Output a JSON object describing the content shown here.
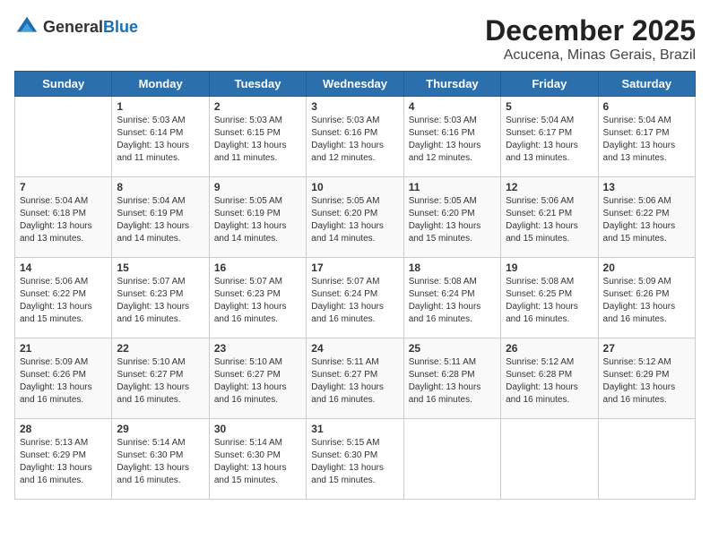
{
  "logo": {
    "general": "General",
    "blue": "Blue"
  },
  "title": {
    "month": "December 2025",
    "location": "Acucena, Minas Gerais, Brazil"
  },
  "weekdays": [
    "Sunday",
    "Monday",
    "Tuesday",
    "Wednesday",
    "Thursday",
    "Friday",
    "Saturday"
  ],
  "weeks": [
    [
      {
        "day": "",
        "info": ""
      },
      {
        "day": "1",
        "info": "Sunrise: 5:03 AM\nSunset: 6:14 PM\nDaylight: 13 hours\nand 11 minutes."
      },
      {
        "day": "2",
        "info": "Sunrise: 5:03 AM\nSunset: 6:15 PM\nDaylight: 13 hours\nand 11 minutes."
      },
      {
        "day": "3",
        "info": "Sunrise: 5:03 AM\nSunset: 6:16 PM\nDaylight: 13 hours\nand 12 minutes."
      },
      {
        "day": "4",
        "info": "Sunrise: 5:03 AM\nSunset: 6:16 PM\nDaylight: 13 hours\nand 12 minutes."
      },
      {
        "day": "5",
        "info": "Sunrise: 5:04 AM\nSunset: 6:17 PM\nDaylight: 13 hours\nand 13 minutes."
      },
      {
        "day": "6",
        "info": "Sunrise: 5:04 AM\nSunset: 6:17 PM\nDaylight: 13 hours\nand 13 minutes."
      }
    ],
    [
      {
        "day": "7",
        "info": "Sunrise: 5:04 AM\nSunset: 6:18 PM\nDaylight: 13 hours\nand 13 minutes."
      },
      {
        "day": "8",
        "info": "Sunrise: 5:04 AM\nSunset: 6:19 PM\nDaylight: 13 hours\nand 14 minutes."
      },
      {
        "day": "9",
        "info": "Sunrise: 5:05 AM\nSunset: 6:19 PM\nDaylight: 13 hours\nand 14 minutes."
      },
      {
        "day": "10",
        "info": "Sunrise: 5:05 AM\nSunset: 6:20 PM\nDaylight: 13 hours\nand 14 minutes."
      },
      {
        "day": "11",
        "info": "Sunrise: 5:05 AM\nSunset: 6:20 PM\nDaylight: 13 hours\nand 15 minutes."
      },
      {
        "day": "12",
        "info": "Sunrise: 5:06 AM\nSunset: 6:21 PM\nDaylight: 13 hours\nand 15 minutes."
      },
      {
        "day": "13",
        "info": "Sunrise: 5:06 AM\nSunset: 6:22 PM\nDaylight: 13 hours\nand 15 minutes."
      }
    ],
    [
      {
        "day": "14",
        "info": "Sunrise: 5:06 AM\nSunset: 6:22 PM\nDaylight: 13 hours\nand 15 minutes."
      },
      {
        "day": "15",
        "info": "Sunrise: 5:07 AM\nSunset: 6:23 PM\nDaylight: 13 hours\nand 16 minutes."
      },
      {
        "day": "16",
        "info": "Sunrise: 5:07 AM\nSunset: 6:23 PM\nDaylight: 13 hours\nand 16 minutes."
      },
      {
        "day": "17",
        "info": "Sunrise: 5:07 AM\nSunset: 6:24 PM\nDaylight: 13 hours\nand 16 minutes."
      },
      {
        "day": "18",
        "info": "Sunrise: 5:08 AM\nSunset: 6:24 PM\nDaylight: 13 hours\nand 16 minutes."
      },
      {
        "day": "19",
        "info": "Sunrise: 5:08 AM\nSunset: 6:25 PM\nDaylight: 13 hours\nand 16 minutes."
      },
      {
        "day": "20",
        "info": "Sunrise: 5:09 AM\nSunset: 6:26 PM\nDaylight: 13 hours\nand 16 minutes."
      }
    ],
    [
      {
        "day": "21",
        "info": "Sunrise: 5:09 AM\nSunset: 6:26 PM\nDaylight: 13 hours\nand 16 minutes."
      },
      {
        "day": "22",
        "info": "Sunrise: 5:10 AM\nSunset: 6:27 PM\nDaylight: 13 hours\nand 16 minutes."
      },
      {
        "day": "23",
        "info": "Sunrise: 5:10 AM\nSunset: 6:27 PM\nDaylight: 13 hours\nand 16 minutes."
      },
      {
        "day": "24",
        "info": "Sunrise: 5:11 AM\nSunset: 6:27 PM\nDaylight: 13 hours\nand 16 minutes."
      },
      {
        "day": "25",
        "info": "Sunrise: 5:11 AM\nSunset: 6:28 PM\nDaylight: 13 hours\nand 16 minutes."
      },
      {
        "day": "26",
        "info": "Sunrise: 5:12 AM\nSunset: 6:28 PM\nDaylight: 13 hours\nand 16 minutes."
      },
      {
        "day": "27",
        "info": "Sunrise: 5:12 AM\nSunset: 6:29 PM\nDaylight: 13 hours\nand 16 minutes."
      }
    ],
    [
      {
        "day": "28",
        "info": "Sunrise: 5:13 AM\nSunset: 6:29 PM\nDaylight: 13 hours\nand 16 minutes."
      },
      {
        "day": "29",
        "info": "Sunrise: 5:14 AM\nSunset: 6:30 PM\nDaylight: 13 hours\nand 16 minutes."
      },
      {
        "day": "30",
        "info": "Sunrise: 5:14 AM\nSunset: 6:30 PM\nDaylight: 13 hours\nand 15 minutes."
      },
      {
        "day": "31",
        "info": "Sunrise: 5:15 AM\nSunset: 6:30 PM\nDaylight: 13 hours\nand 15 minutes."
      },
      {
        "day": "",
        "info": ""
      },
      {
        "day": "",
        "info": ""
      },
      {
        "day": "",
        "info": ""
      }
    ]
  ]
}
